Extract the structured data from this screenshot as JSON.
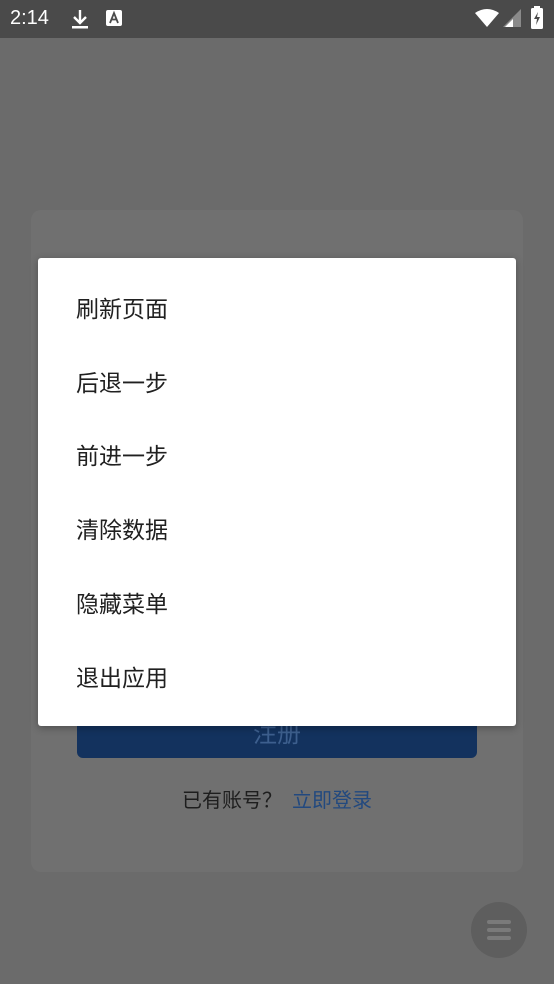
{
  "status_bar": {
    "time": "2:14"
  },
  "card": {
    "register_label": "注册",
    "login_prompt": "已有账号？",
    "login_link": "立即登录"
  },
  "menu": {
    "items": [
      {
        "label": "刷新页面"
      },
      {
        "label": "后退一步"
      },
      {
        "label": "前进一步"
      },
      {
        "label": "清除数据"
      },
      {
        "label": "隐藏菜单"
      },
      {
        "label": "退出应用"
      }
    ]
  },
  "colors": {
    "scrim": "#6b6b6b",
    "primary_dimmed": "#13325e",
    "link_dimmed": "#22497f"
  }
}
